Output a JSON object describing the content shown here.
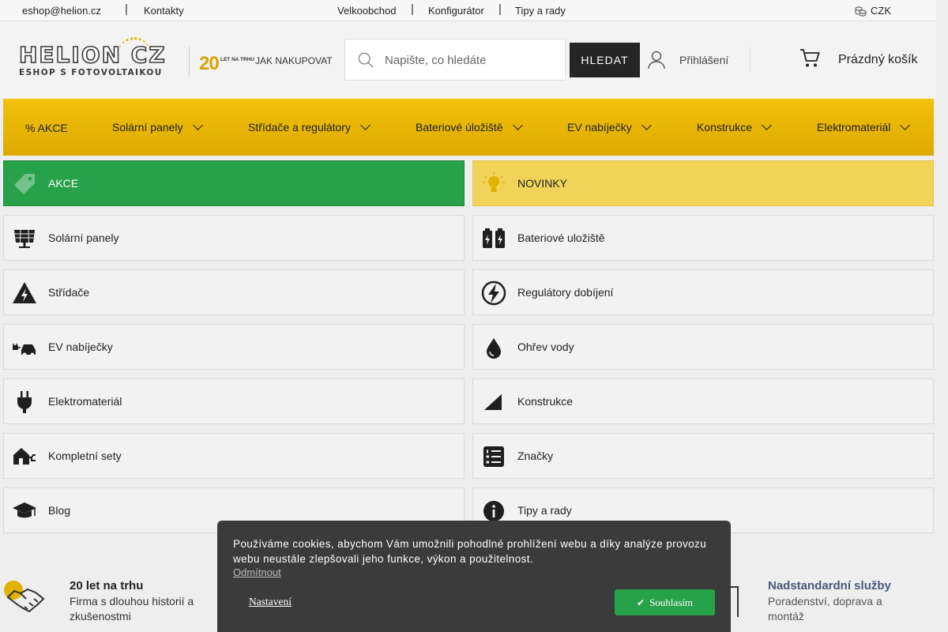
{
  "topbar": {
    "email": "eshop@helion.cz",
    "contacts": "Kontakty",
    "wholesale": "Velkoobchod",
    "configurator": "Konfigurátor",
    "tips": "Tipy a rady",
    "currency": "CZK"
  },
  "header": {
    "logo_text": "HELION CZ",
    "logo_tagline": "ESHOP S FOTOVOLTAIKOU",
    "anniversary_number": "20",
    "anniversary_text": "LET NA TRHU",
    "how_to_buy": "JAK NAKUPOVAT",
    "search_placeholder": "Napište, co hledáte",
    "search_button": "HLEDAT",
    "login": "Přihlášení",
    "cart": "Prázdný košík"
  },
  "nav": {
    "items": [
      {
        "label": "% AKCE"
      },
      {
        "label": "Solární panely"
      },
      {
        "label": "Střídače a regulátory"
      },
      {
        "label": "Bateriové úložiště"
      },
      {
        "label": "EV nabíječky"
      },
      {
        "label": "Konstrukce"
      },
      {
        "label": "Elektromateriál"
      }
    ]
  },
  "categories": [
    {
      "label": "AKCE",
      "icon": "tag-icon"
    },
    {
      "label": "NOVINKY",
      "icon": "lightbulb-icon"
    },
    {
      "label": "Solární panely",
      "icon": "solar-panel-icon"
    },
    {
      "label": "Bateriové uložiště",
      "icon": "battery-icon"
    },
    {
      "label": "Střídače",
      "icon": "inverter-icon"
    },
    {
      "label": "Regulátory dobíjení",
      "icon": "lightning-icon"
    },
    {
      "label": "EV nabíječky",
      "icon": "ev-car-icon"
    },
    {
      "label": "Ohřev vody",
      "icon": "water-drop-icon"
    },
    {
      "label": "Elektromateriál",
      "icon": "plug-icon"
    },
    {
      "label": "Konstrukce",
      "icon": "construction-icon"
    },
    {
      "label": "Kompletní sety",
      "icon": "house-plug-icon"
    },
    {
      "label": "Značky",
      "icon": "list-icon"
    },
    {
      "label": "Blog",
      "icon": "graduation-cap-icon"
    },
    {
      "label": "Tipy a rady",
      "icon": "info-icon"
    }
  ],
  "benefits": [
    {
      "title": "20 let na trhu",
      "desc": "Firma s dlouhou historií a zkušenostmi"
    },
    {
      "title": "Nadstandardní služby",
      "desc": "Poradenství, doprava a montáž"
    }
  ],
  "cookie": {
    "text": "Používáme cookies, abychom Vám umožnili pohodlné prohlížení webu a díky analýze provozu webu neustále zlepšovali jeho funkce, výkon a použitelnost.",
    "reject": "Odmítnout",
    "settings": "Nastavení",
    "accept": "Souhlasím"
  },
  "colors": {
    "nav_yellow": "#f1c10b",
    "akce_green": "#27a14a",
    "novinky_yellow": "#f1d35a",
    "cookie_bg": "#3b3b3b"
  }
}
